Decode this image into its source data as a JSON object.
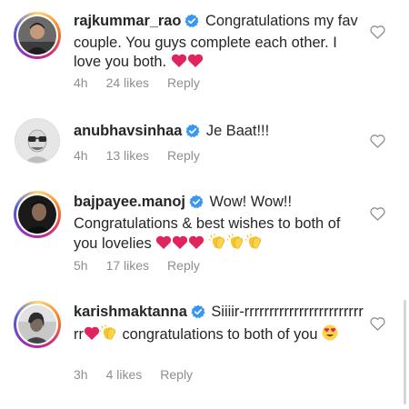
{
  "comments": [
    {
      "username": "rajkummar_rao",
      "verified": true,
      "text": "Congratulations my fav couple. You guys complete each other. I love you both.",
      "emoji": [
        "red-heart",
        "red-heart"
      ],
      "time": "4h",
      "likes": "24 likes",
      "reply": "Reply",
      "story_ring": true
    },
    {
      "username": "anubhavsinhaa",
      "verified": true,
      "text": "Je Baat!!!",
      "emoji": [],
      "time": "4h",
      "likes": "13 likes",
      "reply": "Reply",
      "story_ring": false
    },
    {
      "username": "bajpayee.manoj",
      "verified": true,
      "text": "Wow! Wow!! Congratulations & best wishes to both of you lovelies",
      "emoji": [
        "red-heart",
        "red-heart",
        "red-heart",
        "clapping-hands",
        "clapping-hands",
        "clapping-hands"
      ],
      "time": "5h",
      "likes": "17 likes",
      "reply": "Reply",
      "story_ring": true
    },
    {
      "username": "karishmaktanna",
      "verified": true,
      "text_part1": "Siiiir-rrrrrrrrrrrrrrrrrrrrrrrrrr",
      "text_part2": "congratulations to both of you",
      "emoji": [
        "red-heart",
        "clapping-hands",
        "heart-eyes-face"
      ],
      "time": "3h",
      "likes": "4 likes",
      "reply": "Reply",
      "story_ring": true
    }
  ],
  "colors": {
    "verified": "#3897f0",
    "heart": "#e0245e",
    "meta": "#8e8e8e",
    "text": "#262626"
  },
  "icons": {
    "verified": "verified-badge-icon",
    "like": "heart-outline-icon"
  }
}
